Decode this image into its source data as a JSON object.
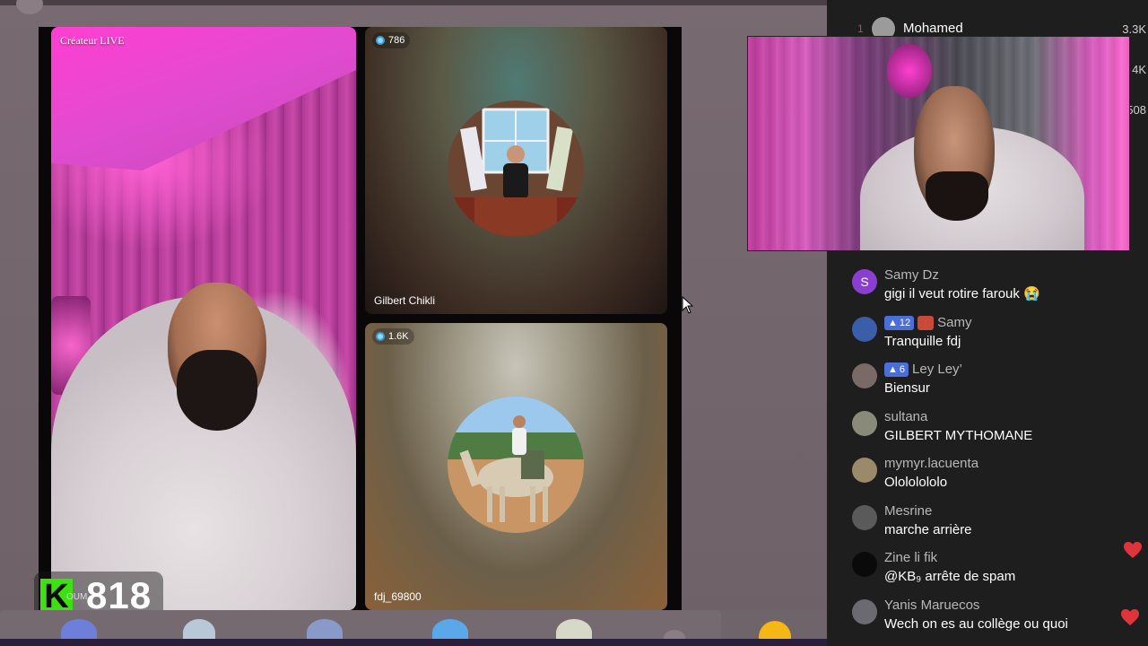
{
  "stage": {
    "host_tag": "Créateur LIVE",
    "guest1": {
      "viewers": "786",
      "name": "Gilbert Chikli"
    },
    "guest2": {
      "viewers": "1.6K",
      "name": "fdj_69800"
    }
  },
  "score": {
    "logo": "K",
    "value": "818",
    "overlay_text": "OUM"
  },
  "ranking": {
    "rank": "1",
    "name": "Mohamed",
    "values": [
      "3.3K",
      "4K",
      "508"
    ]
  },
  "chat": [
    {
      "user": "Samy Dz",
      "initial": "S",
      "text": "gigi il veut rotire farouk 😭",
      "level": "",
      "avatar_color": "#8a3fd1"
    },
    {
      "user": "Samy",
      "text": "Tranquille fdj",
      "level": "12",
      "fan": true,
      "avatar_color": "#3a5fa8"
    },
    {
      "user": "Ley Ley’",
      "text": "Biensur",
      "level": "6",
      "avatar_color": "#7a6a66"
    },
    {
      "user": "sultana",
      "text": "GILBERT MYTHOMANE",
      "level": "",
      "avatar_color": "#8a8a7a"
    },
    {
      "user": "mymyr.lacuenta",
      "text": "Olololololo",
      "level": "",
      "avatar_color": "#9a8a6a"
    },
    {
      "user": "Mesrine",
      "text": "marche arrière",
      "level": "",
      "avatar_color": "#5a5a5a"
    },
    {
      "user": "Zine li fik",
      "text": "@KB₉ arrête de spam",
      "level": "",
      "avatar_color": "#0a0a0a"
    },
    {
      "user": "Yanis Maruecos",
      "text": "Wech on es au collège ou quoi",
      "level": "",
      "avatar_color": "#6a6a70"
    }
  ],
  "colors": {
    "accent_heart": "#e0343c",
    "score_green": "#3ee014",
    "level_blue": "#4a6fd8"
  }
}
